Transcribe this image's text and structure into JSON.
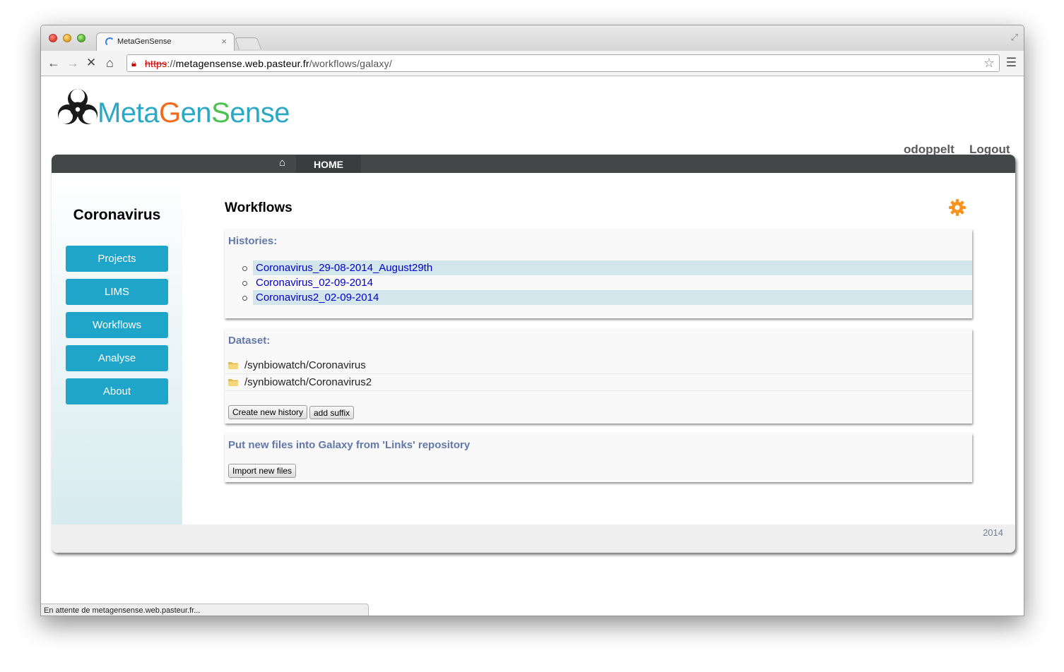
{
  "browser": {
    "tab_title": "MetaGenSense",
    "tab_close": "×",
    "url_scheme": "https",
    "url_sep": "://",
    "url_host": "metagensense.web.pasteur.fr",
    "url_path": "/workflows/galaxy/",
    "status_text": "En attente de metagensense.web.pasteur.fr..."
  },
  "logo": {
    "part1": "M",
    "part2": "eta",
    "part3": "G",
    "part4": "en",
    "part5": "S",
    "part6": "ense"
  },
  "header": {
    "username": "odoppelt",
    "logout_label": "Logout"
  },
  "navbar": {
    "home_label": "HOME"
  },
  "sidebar": {
    "project_name": "Coronavirus",
    "items": [
      {
        "label": "Projects"
      },
      {
        "label": "LIMS"
      },
      {
        "label": "Workflows"
      },
      {
        "label": "Analyse"
      },
      {
        "label": "About"
      }
    ]
  },
  "main": {
    "title": "Workflows",
    "histories": {
      "title": "Histories:",
      "items": [
        "Coronavirus_29-08-2014_August29th",
        "Coronavirus_02-09-2014",
        "Coronavirus2_02-09-2014"
      ]
    },
    "dataset": {
      "title": "Dataset:",
      "items": [
        "/synbiowatch/Coronavirus",
        "/synbiowatch/Coronavirus2"
      ],
      "create_button": "Create new history",
      "suffix_button": "add suffix"
    },
    "import": {
      "title": "Put new files into Galaxy from 'Links' repository",
      "button": "Import new files"
    }
  },
  "footer": {
    "year": "2014"
  },
  "colors": {
    "accent": "#1ea5c9",
    "navbar": "#434748",
    "gear": "#f7931e",
    "panel_title": "#6278a8",
    "link": "#0000cc"
  }
}
